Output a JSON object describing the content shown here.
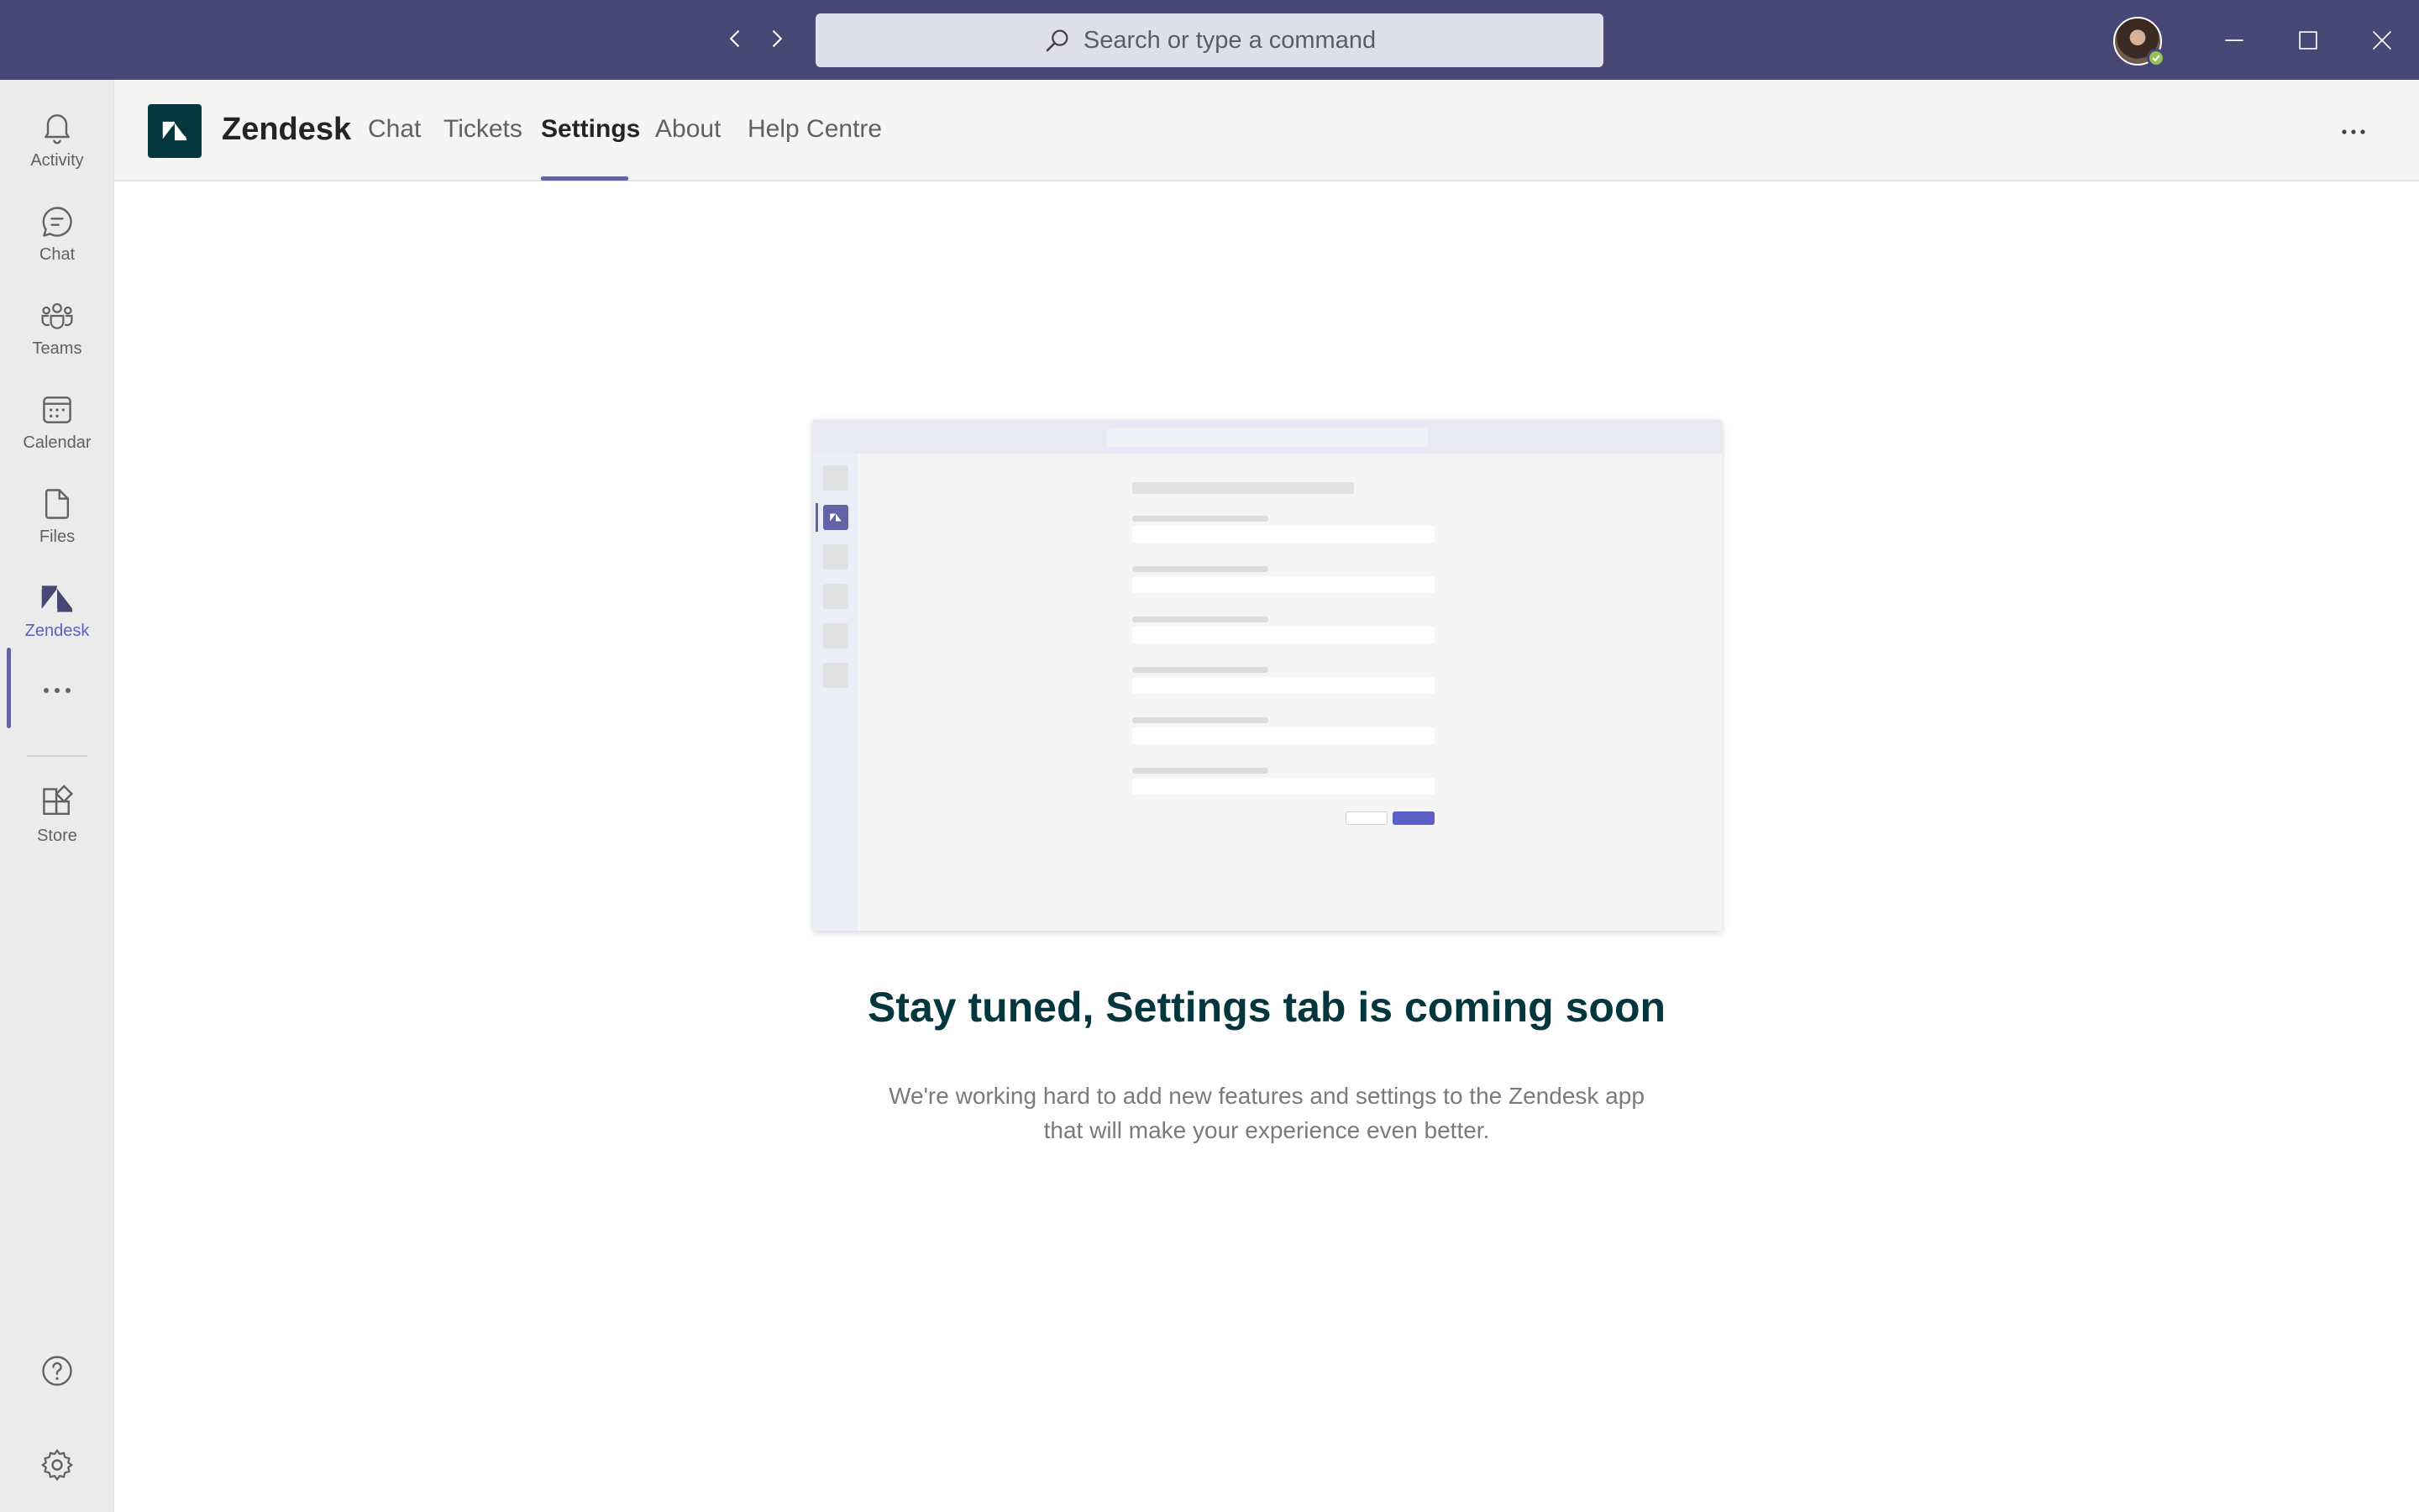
{
  "titlebar": {
    "search_placeholder": "Search or type a command",
    "icons": {
      "back": "chevron-left-icon",
      "forward": "chevron-right-icon",
      "search": "search-icon",
      "minimize": "minimize-icon",
      "maximize": "maximize-icon",
      "close": "close-icon"
    },
    "presence_status_color": "#92c353",
    "bar_color": "#464775"
  },
  "rail": {
    "items": [
      {
        "label": "Activity",
        "icon": "bell-icon"
      },
      {
        "label": "Chat",
        "icon": "chat-icon"
      },
      {
        "label": "Teams",
        "icon": "teams-icon"
      },
      {
        "label": "Calendar",
        "icon": "calendar-icon"
      },
      {
        "label": "Files",
        "icon": "file-icon"
      },
      {
        "label": "Zendesk",
        "icon": "zendesk-icon",
        "active": true
      }
    ],
    "more_icon": "more-horizontal-icon",
    "store": {
      "label": "Store",
      "icon": "store-icon"
    },
    "help_icon": "help-icon",
    "settings_icon": "gear-icon"
  },
  "app": {
    "name": "Zendesk",
    "logo_color": "#03363d",
    "tabs": [
      {
        "label": "Chat"
      },
      {
        "label": "Tickets"
      },
      {
        "label": "Settings",
        "active": true
      },
      {
        "label": "About"
      },
      {
        "label": "Help Centre"
      }
    ],
    "accent_color": "#6264a7"
  },
  "main": {
    "headline": "Stay tuned, Settings tab is coming soon",
    "subtext": "We're working hard to add new features and settings to the Zendesk app that will make your experience even better."
  }
}
